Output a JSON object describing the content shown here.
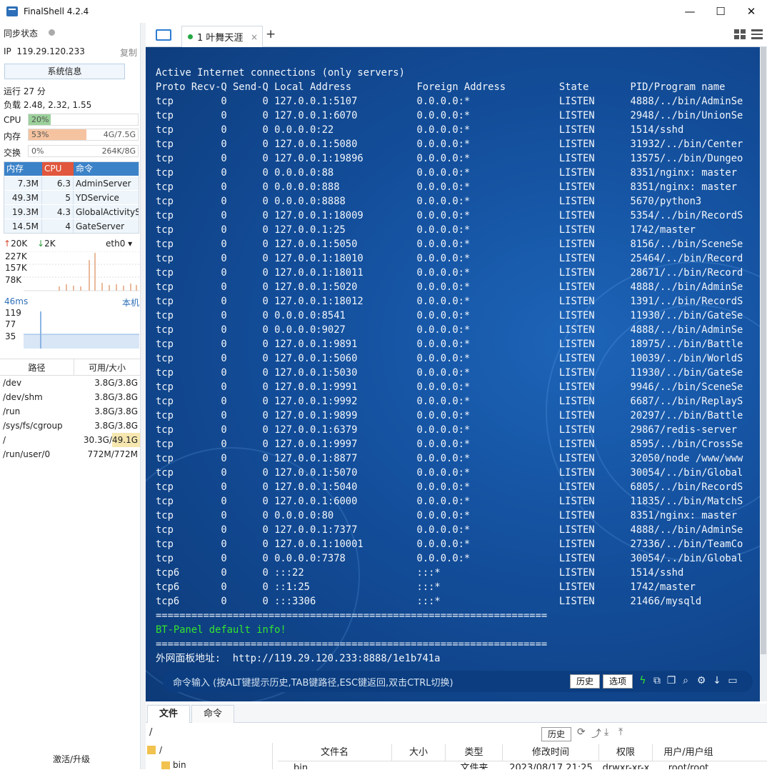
{
  "window": {
    "title": "FinalShell 4.2.4",
    "minimize": "—",
    "maximize": "☐",
    "close": "✕"
  },
  "left": {
    "sync_label": "同步状态",
    "ip_label": "IP",
    "ip": "119.29.120.233",
    "copy": "复制",
    "sysinfo": "系统信息",
    "uptime": "运行 27 分",
    "load": "负载 2.48, 2.32, 1.55",
    "cpu": {
      "label": "CPU",
      "value": "20%",
      "fraction": 0.2
    },
    "mem": {
      "label": "内存",
      "value": "53%",
      "right": "4G/7.5G",
      "fraction": 0.53
    },
    "swap": {
      "label": "交换",
      "value": "0%",
      "right": "264K/8G",
      "fraction": 0
    },
    "proc_headers": [
      "内存",
      "CPU",
      "命令"
    ],
    "procs": [
      {
        "mem": "7.3M",
        "cpu": "6.3",
        "cmd": "AdminServer"
      },
      {
        "mem": "49.3M",
        "cpu": "5",
        "cmd": "YDService"
      },
      {
        "mem": "19.3M",
        "cpu": "4.3",
        "cmd": "GlobalActivityS"
      },
      {
        "mem": "14.5M",
        "cpu": "4",
        "cmd": "GateServer"
      }
    ],
    "net": {
      "up": "20K",
      "down": "2K",
      "iface": "eth0",
      "y1": "227K",
      "y2": "157K",
      "y3": "78K"
    },
    "latency": {
      "ms": "46ms",
      "host": "本机",
      "y1": "119",
      "y2": "77",
      "y3": "35"
    },
    "disk_headers": [
      "路径",
      "可用/大小"
    ],
    "disks": [
      {
        "path": "/dev",
        "size": "3.8G/3.8G"
      },
      {
        "path": "/dev/shm",
        "size": "3.8G/3.8G"
      },
      {
        "path": "/run",
        "size": "3.8G/3.8G"
      },
      {
        "path": "/sys/fs/cgroup",
        "size": "3.8G/3.8G"
      },
      {
        "path": "/",
        "size": "30.3G/49.1G"
      },
      {
        "path": "/run/user/0",
        "size": "772M/772M"
      }
    ],
    "activate": "激活/升级"
  },
  "tabs": {
    "session": "1 叶舞天涯",
    "close": "×",
    "add": "+"
  },
  "terminal": {
    "header1": "Active Internet connections (only servers)",
    "header2": "Proto Recv-Q Send-Q Local Address           Foreign Address         State       PID/Program name",
    "rows": [
      [
        "tcp",
        "0",
        "0",
        "127.0.0.1:5107",
        "0.0.0.0:*",
        "LISTEN",
        "4888/../bin/AdminSe"
      ],
      [
        "tcp",
        "0",
        "0",
        "127.0.0.1:6070",
        "0.0.0.0:*",
        "LISTEN",
        "2948/../bin/UnionSe"
      ],
      [
        "tcp",
        "0",
        "0",
        "0.0.0.0:22",
        "0.0.0.0:*",
        "LISTEN",
        "1514/sshd"
      ],
      [
        "tcp",
        "0",
        "0",
        "127.0.0.1:5080",
        "0.0.0.0:*",
        "LISTEN",
        "31932/../bin/Center"
      ],
      [
        "tcp",
        "0",
        "0",
        "127.0.0.1:19896",
        "0.0.0.0:*",
        "LISTEN",
        "13575/../bin/Dungeo"
      ],
      [
        "tcp",
        "0",
        "0",
        "0.0.0.0:88",
        "0.0.0.0:*",
        "LISTEN",
        "8351/nginx: master"
      ],
      [
        "tcp",
        "0",
        "0",
        "0.0.0.0:888",
        "0.0.0.0:*",
        "LISTEN",
        "8351/nginx: master"
      ],
      [
        "tcp",
        "0",
        "0",
        "0.0.0.0:8888",
        "0.0.0.0:*",
        "LISTEN",
        "5670/python3"
      ],
      [
        "tcp",
        "0",
        "0",
        "127.0.0.1:18009",
        "0.0.0.0:*",
        "LISTEN",
        "5354/../bin/RecordS"
      ],
      [
        "tcp",
        "0",
        "0",
        "127.0.0.1:25",
        "0.0.0.0:*",
        "LISTEN",
        "1742/master"
      ],
      [
        "tcp",
        "0",
        "0",
        "127.0.0.1:5050",
        "0.0.0.0:*",
        "LISTEN",
        "8156/../bin/SceneSe"
      ],
      [
        "tcp",
        "0",
        "0",
        "127.0.0.1:18010",
        "0.0.0.0:*",
        "LISTEN",
        "25464/../bin/Record"
      ],
      [
        "tcp",
        "0",
        "0",
        "127.0.0.1:18011",
        "0.0.0.0:*",
        "LISTEN",
        "28671/../bin/Record"
      ],
      [
        "tcp",
        "0",
        "0",
        "127.0.0.1:5020",
        "0.0.0.0:*",
        "LISTEN",
        "4888/../bin/AdminSe"
      ],
      [
        "tcp",
        "0",
        "0",
        "127.0.0.1:18012",
        "0.0.0.0:*",
        "LISTEN",
        "1391/../bin/RecordS"
      ],
      [
        "tcp",
        "0",
        "0",
        "0.0.0.0:8541",
        "0.0.0.0:*",
        "LISTEN",
        "11930/../bin/GateSe"
      ],
      [
        "tcp",
        "0",
        "0",
        "0.0.0.0:9027",
        "0.0.0.0:*",
        "LISTEN",
        "4888/../bin/AdminSe"
      ],
      [
        "tcp",
        "0",
        "0",
        "127.0.0.1:9891",
        "0.0.0.0:*",
        "LISTEN",
        "18975/../bin/Battle"
      ],
      [
        "tcp",
        "0",
        "0",
        "127.0.0.1:5060",
        "0.0.0.0:*",
        "LISTEN",
        "10039/../bin/WorldS"
      ],
      [
        "tcp",
        "0",
        "0",
        "127.0.0.1:5030",
        "0.0.0.0:*",
        "LISTEN",
        "11930/../bin/GateSe"
      ],
      [
        "tcp",
        "0",
        "0",
        "127.0.0.1:9991",
        "0.0.0.0:*",
        "LISTEN",
        "9946/../bin/SceneSe"
      ],
      [
        "tcp",
        "0",
        "0",
        "127.0.0.1:9992",
        "0.0.0.0:*",
        "LISTEN",
        "6687/../bin/ReplayS"
      ],
      [
        "tcp",
        "0",
        "0",
        "127.0.0.1:9899",
        "0.0.0.0:*",
        "LISTEN",
        "20297/../bin/Battle"
      ],
      [
        "tcp",
        "0",
        "0",
        "127.0.0.1:6379",
        "0.0.0.0:*",
        "LISTEN",
        "29867/redis-server"
      ],
      [
        "tcp",
        "0",
        "0",
        "127.0.0.1:9997",
        "0.0.0.0:*",
        "LISTEN",
        "8595/../bin/CrossSe"
      ],
      [
        "tcp",
        "0",
        "0",
        "127.0.0.1:8877",
        "0.0.0.0:*",
        "LISTEN",
        "32050/node /www/www"
      ],
      [
        "tcp",
        "0",
        "0",
        "127.0.0.1:5070",
        "0.0.0.0:*",
        "LISTEN",
        "30054/../bin/Global"
      ],
      [
        "tcp",
        "0",
        "0",
        "127.0.0.1:5040",
        "0.0.0.0:*",
        "LISTEN",
        "6805/../bin/RecordS"
      ],
      [
        "tcp",
        "0",
        "0",
        "127.0.0.1:6000",
        "0.0.0.0:*",
        "LISTEN",
        "11835/../bin/MatchS"
      ],
      [
        "tcp",
        "0",
        "0",
        "0.0.0.0:80",
        "0.0.0.0:*",
        "LISTEN",
        "8351/nginx: master"
      ],
      [
        "tcp",
        "0",
        "0",
        "127.0.0.1:7377",
        "0.0.0.0:*",
        "LISTEN",
        "4888/../bin/AdminSe"
      ],
      [
        "tcp",
        "0",
        "0",
        "127.0.0.1:10001",
        "0.0.0.0:*",
        "LISTEN",
        "27336/../bin/TeamCo"
      ],
      [
        "tcp",
        "0",
        "0",
        "0.0.0.0:7378",
        "0.0.0.0:*",
        "LISTEN",
        "30054/../bin/Global"
      ],
      [
        "tcp6",
        "0",
        "0",
        ":::22",
        ":::*",
        "LISTEN",
        "1514/sshd"
      ],
      [
        "tcp6",
        "0",
        "0",
        "::1:25",
        ":::*",
        "LISTEN",
        "1742/master"
      ],
      [
        "tcp6",
        "0",
        "0",
        ":::3306",
        ":::*",
        "LISTEN",
        "21466/mysqld"
      ]
    ],
    "sep": "==================================================================",
    "bt_info": "BT-Panel default info!",
    "panel_line": "外网面板地址:  http://119.29.120.233:8888/1e1b741a",
    "cmd_placeholder": "命令输入 (按ALT键提示历史,TAB键路径,ESC键返回,双击CTRL切换)",
    "history_btn": "历史",
    "options_btn": "选项"
  },
  "files": {
    "tab_files": "文件",
    "tab_cmd": "命令",
    "path": "/",
    "history_btn": "历史",
    "tree_root": "/",
    "tree_item": "bin",
    "columns": [
      "文件名",
      "大小",
      "类型",
      "修改时间",
      "权限",
      "用户/用户组"
    ],
    "row": {
      "name": "bin",
      "size": "",
      "type": "文件夹",
      "mtime": "2023/08/17 21:25",
      "perm": "drwxr-xr-x",
      "owner": "root/root"
    }
  },
  "colors": {
    "accent": "#3b82c8",
    "cpu_fill": "#9bd19b",
    "mem_fill": "#f6c3a0",
    "term_green": "#35e52d"
  }
}
